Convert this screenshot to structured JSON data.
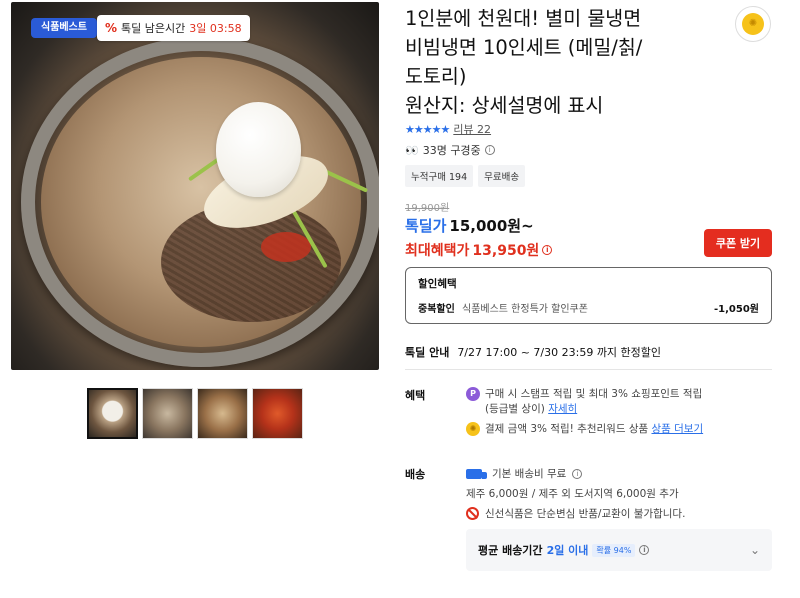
{
  "hero": {
    "store_badge": "식품베스트",
    "timer_icon": "percent-icon",
    "timer_label": "톡딜 남은시간",
    "timer_value": "3일 03:58"
  },
  "thumbnails": [
    "thumb-1",
    "thumb-2",
    "thumb-3",
    "thumb-4"
  ],
  "title": {
    "line1": "1인분에 천원대! 별미 물냉면",
    "line2": "비빔냉면 10인세트 (메밀/칡/",
    "line3": "도토리)",
    "line4": "원산지: 상세설명에 표시"
  },
  "rating": {
    "stars": "★★★★★",
    "reviews": "리뷰 22"
  },
  "viewing": {
    "text": "33명 구경중"
  },
  "chips": [
    "누적구매 194",
    "무료배송"
  ],
  "price": {
    "original": "19,900원",
    "deal_label": "톡딜가",
    "deal_value": "15,000원~",
    "max_label": "최대혜택가",
    "max_value": "13,950원"
  },
  "coupon_button": "쿠폰 받기",
  "discount": {
    "heading": "할인혜택",
    "row_label": "중복할인",
    "row_desc": "식품베스트 한정특가 할인쿠폰",
    "row_amount": "-1,050원"
  },
  "deal_info": {
    "label": "톡딜 안내",
    "period": "7/27 17:00 ~ 7/30 23:59 까지 한정할인"
  },
  "benefits": {
    "label": "혜택",
    "row1_line1": "구매 시 스탬프 적립 및 최대 3% 쇼핑포인트 적립",
    "row1_line2_prefix": "(등급별 상이)",
    "row1_link": "자세히",
    "row2_text": "결제 금액 3% 적립! 추천리워드 상품",
    "row2_link": "상품 더보기"
  },
  "shipping": {
    "label": "배송",
    "basic": "기본 배송비 무료",
    "extra": "제주 6,000원 / 제주 외 도서지역 6,000원 추가",
    "fresh": "신선식품은 단순변심 반품/교환이 불가합니다.",
    "avg_label": "평균 배송기간",
    "avg_value": "2일 이내",
    "avg_pct": "확률 94%"
  },
  "colors": {
    "accent_blue": "#2a6fe8",
    "accent_red": "#e42d1f"
  }
}
